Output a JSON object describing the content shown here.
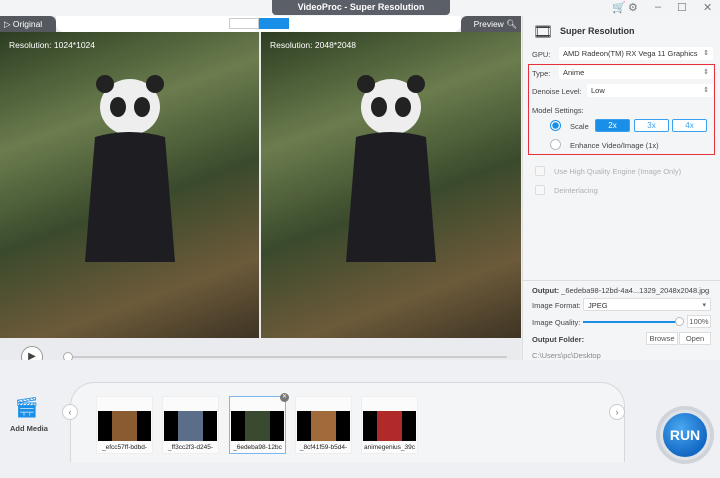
{
  "window": {
    "title": "VideoProc  -  Super Resolution"
  },
  "preview": {
    "original_tab": "▷ Original",
    "preview_tab": "Preview",
    "left_resolution": "Resolution: 1024*1024",
    "right_resolution": "Resolution: 2048*2048"
  },
  "panel": {
    "title": "Super Resolution",
    "gpu_label": "GPU:",
    "gpu_value": "AMD Radeon(TM) RX Vega 11 Graphics",
    "type_label": "Type:",
    "type_value": "Anime",
    "denoise_label": "Denoise Level:",
    "denoise_value": "Low",
    "model_label": "Model Settings:",
    "scale_label": "Scale",
    "scale_options": [
      "2x",
      "3x",
      "4x"
    ],
    "scale_selected": "2x",
    "enhance_label": "Enhance Video/Image (1x)",
    "hq_label": "Use High Quality Engine (Image Only)",
    "deinterlace_label": "Deinterlacing"
  },
  "output": {
    "label": "Output:",
    "filename": "_6edeba98-12bd-4a4...1329_2048x2048.jpg",
    "format_label": "Image Format:",
    "format_value": "JPEG",
    "quality_label": "Image Quality:",
    "quality_value": "100%",
    "quality_percent": 100,
    "folder_label": "Output Folder:",
    "browse": "Browse",
    "open": "Open",
    "folder_path": "C:\\Users\\pc\\Desktop"
  },
  "media": {
    "add_label": "Add Media",
    "run_label": "RUN",
    "items": [
      {
        "name": "_efcc57ff-bdbd-"
      },
      {
        "name": "_ff3cc2f3-d245-"
      },
      {
        "name": "_6edeba98-12bc"
      },
      {
        "name": "_8cf41f59-b5d4-"
      },
      {
        "name": "animegenius_39c"
      }
    ]
  },
  "colors": {
    "accent": "#1a8fe8",
    "highlight_box": "#e8303a"
  }
}
